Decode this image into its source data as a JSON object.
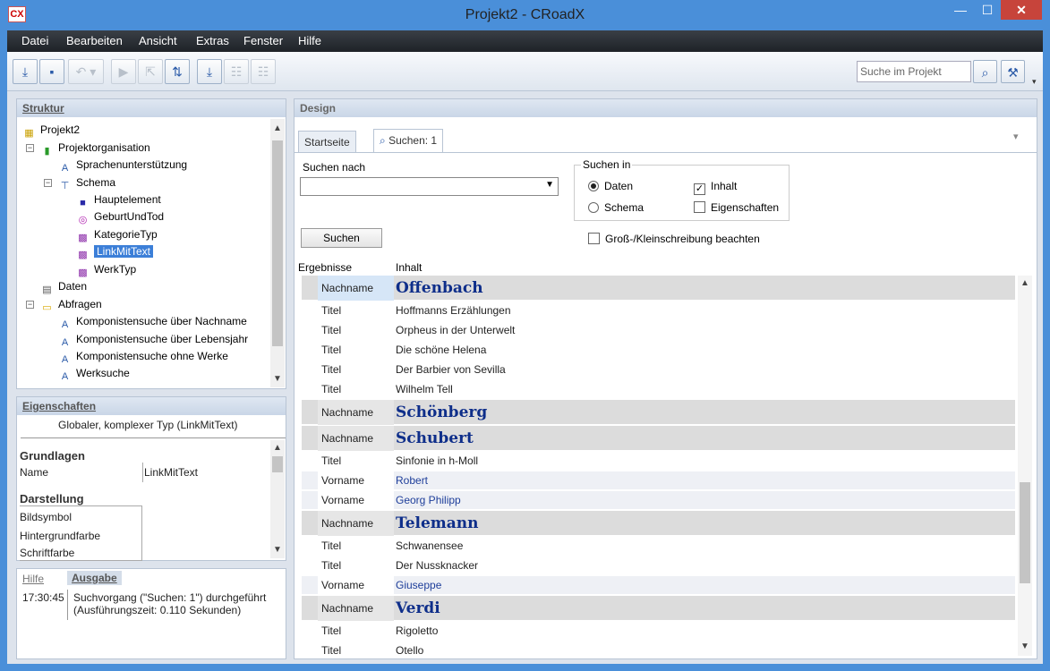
{
  "window": {
    "title": "Projekt2 - CRoadX",
    "app_icon": "CX",
    "minimize": "—",
    "maximize": "☐",
    "close": "✕"
  },
  "menu": [
    "Datei",
    "Bearbeiten",
    "Ansicht",
    "Extras",
    "Fenster",
    "Hilfe"
  ],
  "toolbar": {
    "search_placeholder": "Suche im Projekt"
  },
  "structure": {
    "title": "Struktur",
    "nodes": [
      "Projekt2",
      "Projektorganisation",
      "Sprachenunterstützung",
      "Schema",
      "Hauptelement",
      "GeburtUndTod",
      "KategorieTyp",
      "LinkMitText",
      "WerkTyp",
      "Daten",
      "Abfragen",
      "Komponistensuche über Nachname",
      "Komponistensuche über Lebensjahr",
      "Komponistensuche ohne Werke",
      "Werksuche"
    ]
  },
  "properties": {
    "title": "Eigenschaften",
    "subtitle": "Globaler, komplexer Typ (LinkMitText)",
    "group1": "Grundlagen",
    "name_label": "Name",
    "name_value": "LinkMitText",
    "group2": "Darstellung",
    "items": [
      "Bildsymbol",
      "Hintergrundfarbe",
      "Schriftfarbe"
    ]
  },
  "output": {
    "tab_help": "Hilfe",
    "tab_output": "Ausgabe",
    "time": "17:30:45",
    "line1": "Suchvorgang (\"Suchen: 1\") durchgeführt",
    "line2": "(Ausführungszeit: 0.110 Sekunden)"
  },
  "design": {
    "title": "Design",
    "tabs": [
      "Startseite",
      "Suchen: 1"
    ],
    "search_label": "Suchen nach",
    "search_value": "",
    "search_button": "Suchen",
    "search_in_label": "Suchen in",
    "opt_data": "Daten",
    "opt_schema": "Schema",
    "chk_content": "Inhalt",
    "chk_props": "Eigenschaften",
    "chk_case": "Groß-/Kleinschreibung beachten",
    "col_results": "Ergebnisse",
    "col_content": "Inhalt"
  },
  "results": [
    {
      "label": "Nachname",
      "value": "Offenbach",
      "kind": "name"
    },
    {
      "label": "Titel",
      "value": "Hoffmanns Erzählungen",
      "kind": "title"
    },
    {
      "label": "Titel",
      "value": "Orpheus in der Unterwelt",
      "kind": "title"
    },
    {
      "label": "Titel",
      "value": "Die schöne Helena",
      "kind": "title"
    },
    {
      "label": "Titel",
      "value": "Der Barbier von Sevilla",
      "kind": "title"
    },
    {
      "label": "Titel",
      "value": "Wilhelm Tell",
      "kind": "title"
    },
    {
      "label": "Nachname",
      "value": "Schönberg",
      "kind": "name"
    },
    {
      "label": "Nachname",
      "value": "Schubert",
      "kind": "name"
    },
    {
      "label": "Titel",
      "value": "Sinfonie in h-Moll",
      "kind": "title"
    },
    {
      "label": "Vorname",
      "value": "Robert",
      "kind": "vorname"
    },
    {
      "label": "Vorname",
      "value": "Georg Philipp",
      "kind": "vorname"
    },
    {
      "label": "Nachname",
      "value": "Telemann",
      "kind": "name"
    },
    {
      "label": "Titel",
      "value": "Schwanensee",
      "kind": "title"
    },
    {
      "label": "Titel",
      "value": "Der Nussknacker",
      "kind": "title"
    },
    {
      "label": "Vorname",
      "value": "Giuseppe",
      "kind": "vorname"
    },
    {
      "label": "Nachname",
      "value": "Verdi",
      "kind": "name"
    },
    {
      "label": "Titel",
      "value": "Rigoletto",
      "kind": "title"
    },
    {
      "label": "Titel",
      "value": "Otello",
      "kind": "title"
    }
  ]
}
